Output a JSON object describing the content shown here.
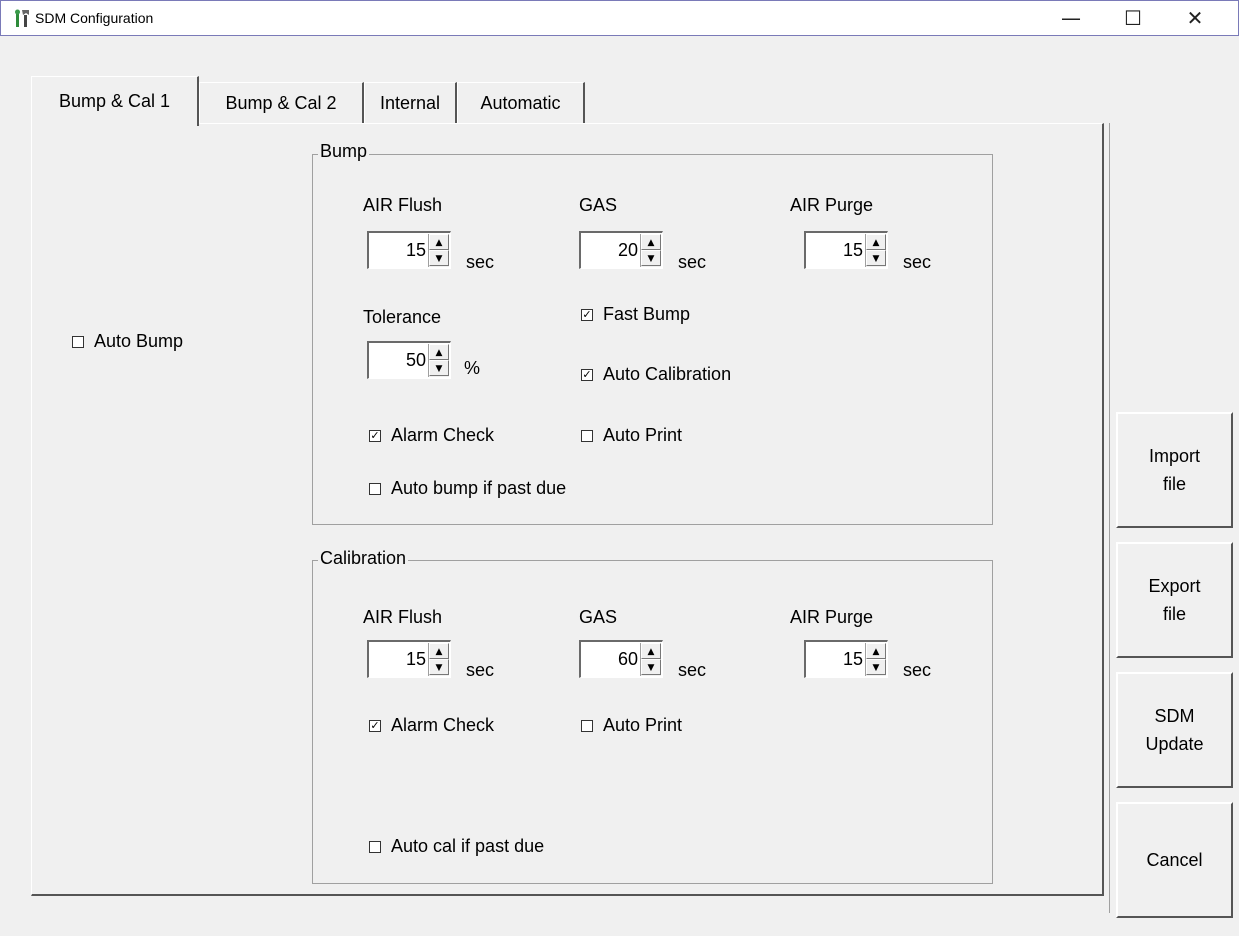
{
  "window": {
    "title": "SDM Configuration",
    "minimize": "—",
    "maximize": "☐",
    "close": "✕"
  },
  "tabs": [
    {
      "label": "Bump & Cal 1",
      "active": true
    },
    {
      "label": "Bump & Cal 2",
      "active": false
    },
    {
      "label": "Internal",
      "active": false
    },
    {
      "label": "Automatic",
      "active": false
    }
  ],
  "auto_bump": {
    "label": "Auto Bump",
    "checked": false
  },
  "bump": {
    "title": "Bump",
    "air_flush_label": "AIR Flush",
    "air_flush_value": "15",
    "air_flush_unit": "sec",
    "gas_label": "GAS",
    "gas_value": "20",
    "gas_unit": "sec",
    "air_purge_label": "AIR Purge",
    "air_purge_value": "15",
    "air_purge_unit": "sec",
    "tolerance_label": "Tolerance",
    "tolerance_value": "50",
    "tolerance_unit": "%",
    "fast_bump": {
      "label": "Fast Bump",
      "checked": true
    },
    "auto_calibration": {
      "label": "Auto Calibration",
      "checked": true
    },
    "alarm_check": {
      "label": "Alarm Check",
      "checked": true
    },
    "auto_print": {
      "label": "Auto Print",
      "checked": false
    },
    "auto_bump_past_due": {
      "label": "Auto bump if past due",
      "checked": false
    }
  },
  "calibration": {
    "title": "Calibration",
    "air_flush_label": "AIR Flush",
    "air_flush_value": "15",
    "air_flush_unit": "sec",
    "gas_label": "GAS",
    "gas_value": "60",
    "gas_unit": "sec",
    "air_purge_label": "AIR Purge",
    "air_purge_value": "15",
    "air_purge_unit": "sec",
    "alarm_check": {
      "label": "Alarm Check",
      "checked": true
    },
    "auto_print": {
      "label": "Auto Print",
      "checked": false
    },
    "auto_cal_past_due": {
      "label": "Auto cal if past due",
      "checked": false
    }
  },
  "buttons": {
    "import": "Import\nfile",
    "export": "Export\nfile",
    "sdm_update": "SDM\nUpdate",
    "cancel": "Cancel"
  },
  "icons": {
    "app": "tools-icon",
    "spin_up": "▲",
    "spin_down": "▼",
    "check": "✓"
  }
}
